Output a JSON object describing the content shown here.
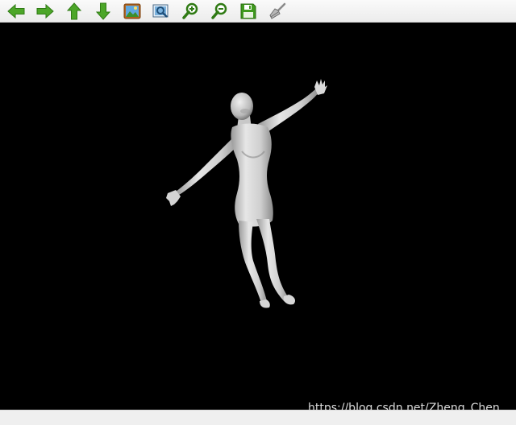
{
  "toolbar": {
    "buttons": [
      {
        "name": "arrow-left-icon",
        "title": "Previous"
      },
      {
        "name": "arrow-right-icon",
        "title": "Next"
      },
      {
        "name": "arrow-up-icon",
        "title": "Up"
      },
      {
        "name": "arrow-down-icon",
        "title": "Down"
      },
      {
        "name": "image-icon",
        "title": "Show image"
      },
      {
        "name": "view-image-icon",
        "title": "View"
      },
      {
        "name": "zoom-in-icon",
        "title": "Zoom in"
      },
      {
        "name": "zoom-out-icon",
        "title": "Zoom out"
      },
      {
        "name": "save-icon",
        "title": "Save"
      },
      {
        "name": "brush-icon",
        "title": "Clear"
      }
    ],
    "colors": {
      "arrow": "#3f9a1e",
      "arrow_light": "#6cc23a"
    }
  },
  "viewport": {
    "background": "#000000",
    "content": "human-body-3d-model",
    "watermark": "https://blog.csdn.net/Zheng_Chen_"
  }
}
